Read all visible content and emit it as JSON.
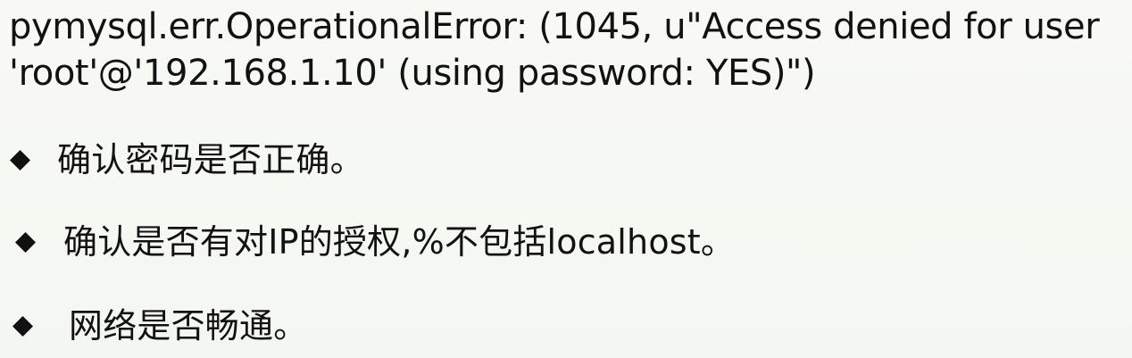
{
  "error": {
    "line1": "pymysql.err.OperationalError: (1045, u\"Access denied for user",
    "line2": "'root'@'192.168.1.10' (using password: YES)\")"
  },
  "bullets": [
    {
      "icon": "diamond-icon",
      "text": "确认密码是否正确。"
    },
    {
      "icon": "diamond-icon",
      "text": "确认是否有对IP的授权,%不包括localhost。"
    },
    {
      "icon": "diamond-icon",
      "text": "网络是否畅通。"
    }
  ],
  "colors": {
    "background": "#f6f8f3",
    "text": "#121212"
  }
}
